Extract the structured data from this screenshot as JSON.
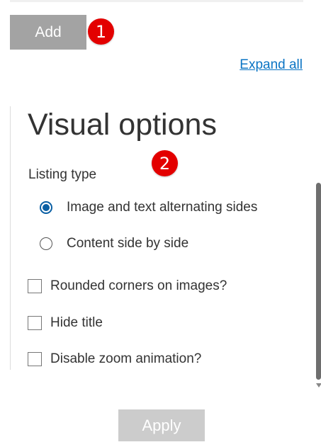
{
  "toolbar": {
    "add_label": "Add",
    "expand_all_label": "Expand all"
  },
  "markers": [
    "1",
    "2"
  ],
  "visual_options": {
    "title": "Visual options",
    "listing_type_label": "Listing type",
    "listing_types": [
      {
        "label": "Image and text alternating sides",
        "selected": true
      },
      {
        "label": "Content side by side",
        "selected": false
      }
    ],
    "checkboxes": [
      {
        "label": "Rounded corners on images?",
        "checked": false
      },
      {
        "label": "Hide title",
        "checked": false
      },
      {
        "label": "Disable zoom animation?",
        "checked": false
      }
    ]
  },
  "footer": {
    "apply_label": "Apply"
  },
  "colors": {
    "add_button": "#a3a3a3",
    "marker": "#e30000",
    "link": "#0a74c4",
    "radio_selected": "#0a5fa4",
    "apply_button": "#cccccc"
  }
}
